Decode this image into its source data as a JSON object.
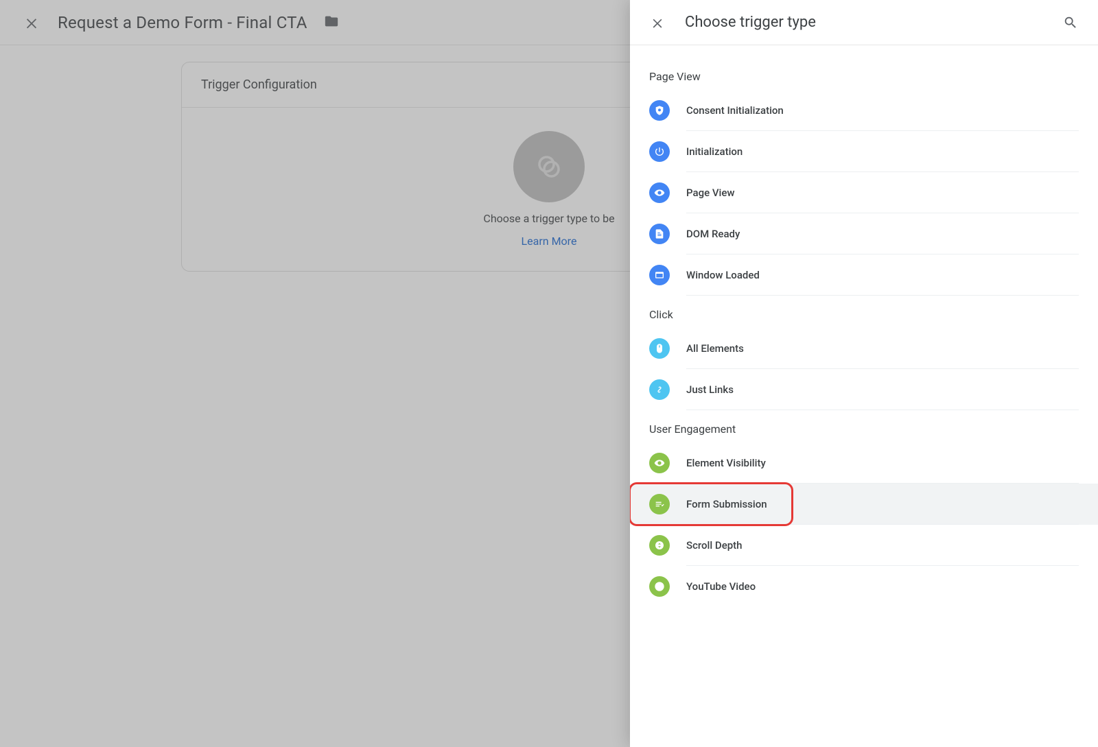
{
  "bg": {
    "title": "Request a Demo Form - Final CTA",
    "cardTitle": "Trigger Configuration",
    "placeholderLine": "Choose a trigger type to be",
    "learnMore": "Learn More"
  },
  "drawer": {
    "title": "Choose trigger type",
    "sections": [
      {
        "title": "Page View",
        "items": [
          {
            "id": "consent-init",
            "label": "Consent Initialization",
            "iconColor": "blue",
            "icon": "shield"
          },
          {
            "id": "init",
            "label": "Initialization",
            "iconColor": "blue",
            "icon": "power"
          },
          {
            "id": "page-view",
            "label": "Page View",
            "iconColor": "blue",
            "icon": "eye"
          },
          {
            "id": "dom-ready",
            "label": "DOM Ready",
            "iconColor": "blue",
            "icon": "doc"
          },
          {
            "id": "window-loaded",
            "label": "Window Loaded",
            "iconColor": "blue",
            "icon": "window"
          }
        ]
      },
      {
        "title": "Click",
        "items": [
          {
            "id": "all-elements",
            "label": "All Elements",
            "iconColor": "cyan",
            "icon": "mouse"
          },
          {
            "id": "just-links",
            "label": "Just Links",
            "iconColor": "cyan",
            "icon": "link"
          }
        ]
      },
      {
        "title": "User Engagement",
        "items": [
          {
            "id": "element-visibility",
            "label": "Element Visibility",
            "iconColor": "green",
            "icon": "eye"
          },
          {
            "id": "form-submission",
            "label": "Form Submission",
            "iconColor": "green",
            "icon": "form",
            "highlight": true
          },
          {
            "id": "scroll-depth",
            "label": "Scroll Depth",
            "iconColor": "green",
            "icon": "scroll"
          },
          {
            "id": "youtube-video",
            "label": "YouTube Video",
            "iconColor": "green",
            "icon": "play",
            "lastInSection": true
          }
        ]
      }
    ]
  },
  "colors": {
    "highlight": "#e53935",
    "link": "#1967d2",
    "blue": "#4285f4",
    "cyan": "#4ec5f1",
    "green": "#8bc34a"
  }
}
